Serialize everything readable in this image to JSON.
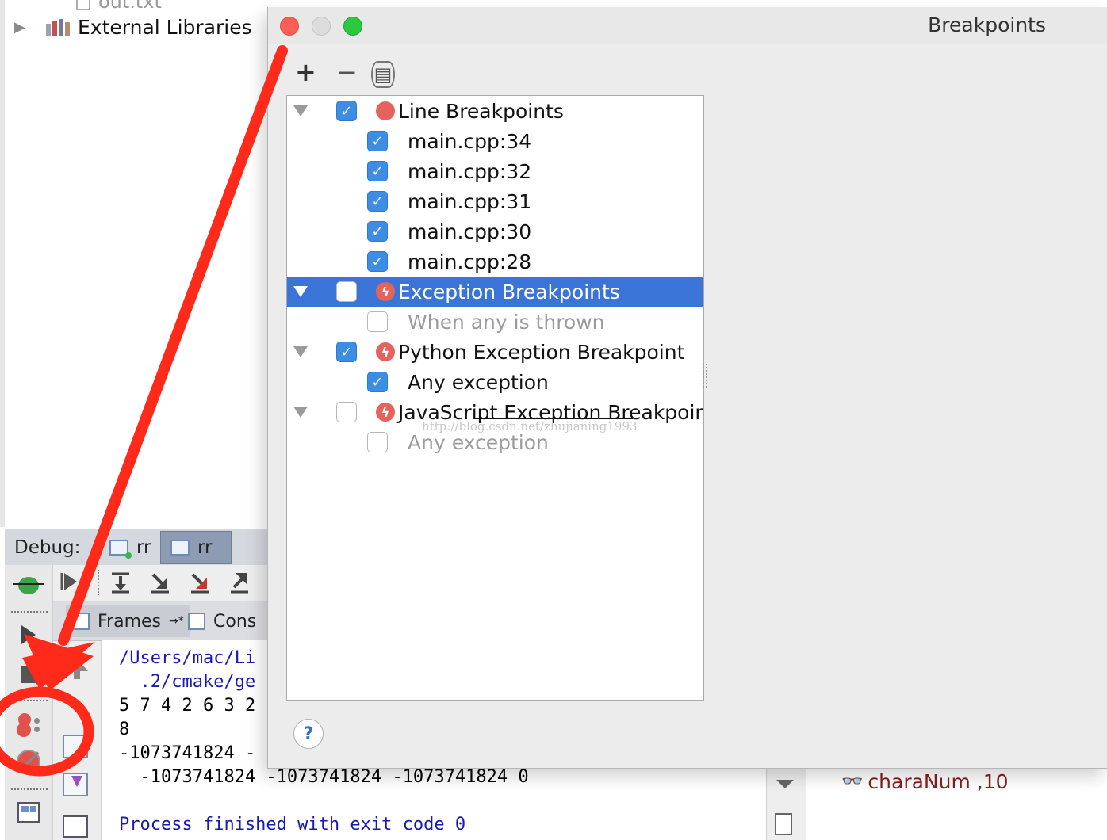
{
  "project": {
    "file_label": "out.txt",
    "tree_item": "External Libraries"
  },
  "debug": {
    "label": "Debug:",
    "tabs": [
      {
        "label": "rr"
      },
      {
        "label": "rr"
      }
    ],
    "frames_tab": "Frames",
    "frames_suffix": "→*",
    "console_tab": "Cons"
  },
  "console": {
    "lines": [
      "/Users/mac/Li",
      "  .2/cmake/ge",
      "5 7 4 2 6 3 2",
      "8",
      "-1073741824 -",
      "  -1073741824 -1073741824 -1073741824 0",
      "",
      "Process finished with exit code 0"
    ]
  },
  "variables": {
    "item": "charaNum ,10"
  },
  "dialog": {
    "title": "Breakpoints",
    "add_label": "+",
    "remove_label": "−",
    "help_label": "?",
    "watermark": "http://blog.csdn.net/zhujianing1993",
    "groups": [
      {
        "label": "Line Breakpoints",
        "checked": true,
        "icon": "line-breakpoint-icon",
        "children": [
          {
            "label": "main.cpp:34",
            "checked": true
          },
          {
            "label": "main.cpp:32",
            "checked": true
          },
          {
            "label": "main.cpp:31",
            "checked": true
          },
          {
            "label": "main.cpp:30",
            "checked": true
          },
          {
            "label": "main.cpp:28",
            "checked": true
          }
        ]
      },
      {
        "label": "Exception Breakpoints",
        "checked": false,
        "selected": true,
        "icon": "exception-breakpoint-icon",
        "children": [
          {
            "label": "When any is thrown",
            "checked": false
          }
        ]
      },
      {
        "label": "Python Exception Breakpoint",
        "checked": true,
        "icon": "exception-breakpoint-icon",
        "children": [
          {
            "label": "Any exception",
            "checked": true
          }
        ]
      },
      {
        "label": "JavaScript Exception Breakpoints",
        "checked": false,
        "icon": "exception-breakpoint-icon",
        "children": [
          {
            "label": "Any exception",
            "checked": false
          }
        ]
      }
    ]
  },
  "colors": {
    "selection": "#3b74d7",
    "checkbox": "#3e8de5",
    "annotation": "#ff2a1a",
    "breakpoint_red": "#e5635c"
  }
}
